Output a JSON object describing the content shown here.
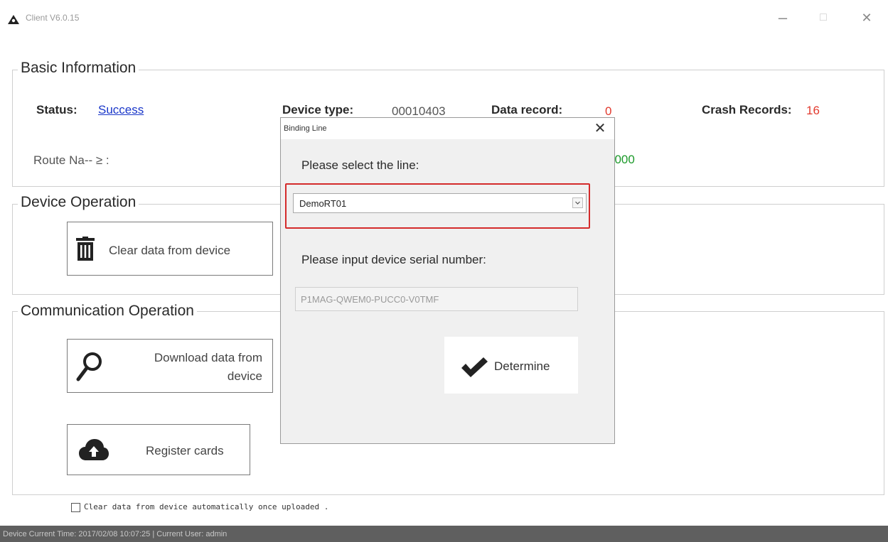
{
  "window": {
    "title": "Client V6.0.15",
    "minimize_glyph": "–",
    "maximize_glyph": "□",
    "close_glyph": "✕"
  },
  "basic_info": {
    "group_title": "Basic Information",
    "status_label": "Status:",
    "status_value": "Success",
    "device_type_label": "Device type:",
    "device_type_value": "00010403",
    "data_record_label": "Data record:",
    "data_record_value": "0",
    "crash_records_label": "Crash Records:",
    "crash_records_value": "16",
    "route_label": "Route Na‐‐ ≥ :",
    "hidden_value_suffix": "0000"
  },
  "device_operation": {
    "group_title": "Device Operation",
    "clear_button": "Clear data from device"
  },
  "communication_operation": {
    "group_title": "Communication Operation",
    "download_button_line1": "Download data from",
    "download_button_line2": "device",
    "register_button": "Register cards"
  },
  "auto_clear": {
    "label": "Clear data from device automatically once uploaded .",
    "checked": false
  },
  "statusbar": {
    "text": "Device Current Time:  2017/02/08 10:07:25  |  Current User:  admin"
  },
  "dialog": {
    "title": "Binding Line",
    "close_glyph": "✕",
    "select_label": "Please select the line:",
    "select_value": "DemoRT01",
    "serial_label": "Please input device serial number:",
    "serial_value": "P1MAG-QWEM0-PUCC0-V0TMF",
    "determine_button": "Determine"
  },
  "colors": {
    "link": "#1a37c9",
    "red": "#e23a2e",
    "green": "#1c9a2a",
    "highlight": "#d42b2b",
    "statusbar": "#5f5f5f"
  },
  "icons": [
    "app-logo-icon",
    "trash-icon",
    "search-icon",
    "cloud-upload-icon",
    "checkmark-icon",
    "chevron-down-icon"
  ]
}
